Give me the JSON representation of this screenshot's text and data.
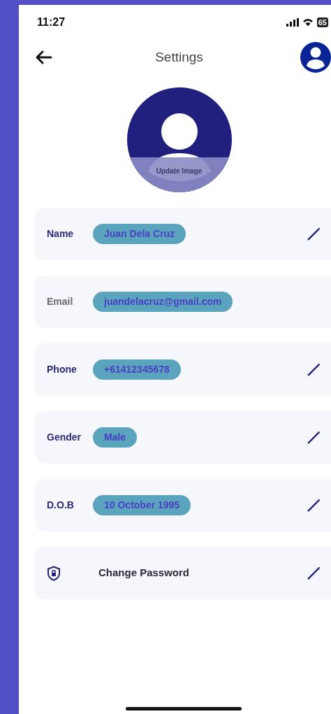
{
  "status_bar": {
    "time": "11:27",
    "battery": "65"
  },
  "header": {
    "title": "Settings"
  },
  "avatar": {
    "caption": "Update Image"
  },
  "fields": [
    {
      "kind": "field",
      "label": "Name",
      "value": "Juan Dela Cruz",
      "editable": true
    },
    {
      "kind": "field",
      "label": "Email",
      "value": "juandelacruz@gmail.com",
      "editable": false
    },
    {
      "kind": "field",
      "label": "Phone",
      "value": "+61412345678",
      "editable": true
    },
    {
      "kind": "field",
      "label": "Gender",
      "value": "Male",
      "editable": true
    },
    {
      "kind": "field",
      "label": "D.O.B",
      "value": "10 October 1995",
      "editable": true
    },
    {
      "kind": "action",
      "label": "Change Password",
      "editable": true
    }
  ]
}
